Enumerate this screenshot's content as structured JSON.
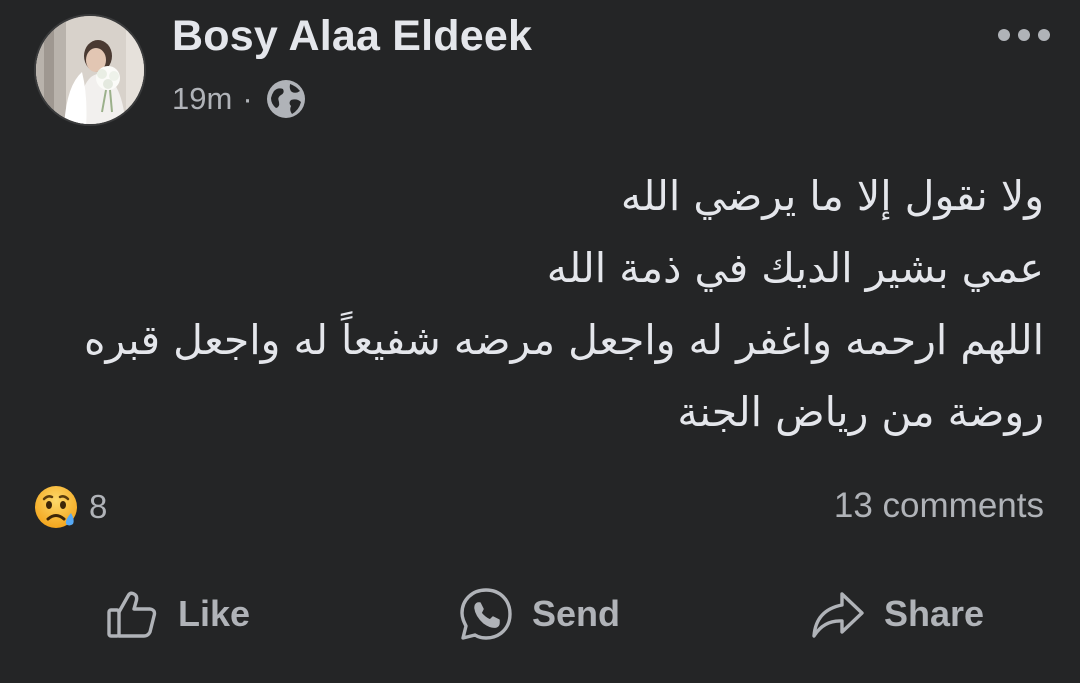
{
  "post": {
    "author": "Bosy Alaa Eldeek",
    "time": "19m",
    "separator": "·",
    "audience_icon": "globe-icon",
    "menu_icon": "more-options-icon",
    "avatar_icon": "profile-photo",
    "text_lines": [
      "ولا نقول إلا ما يرضي الله",
      "عمي بشير الديك في ذمة الله",
      "اللهم ارحمه واغفر له واجعل مرضه شفيعاً له واجعل قبره",
      "روضة من رياض الجنة"
    ]
  },
  "stats": {
    "reaction_icon": "sad-reaction-icon",
    "reaction_count": "8",
    "comments": "13 comments"
  },
  "actions": {
    "like": {
      "label": "Like",
      "icon": "thumbs-up-icon"
    },
    "send": {
      "label": "Send",
      "icon": "messenger-send-icon"
    },
    "share": {
      "label": "Share",
      "icon": "share-arrow-icon"
    }
  },
  "colors": {
    "background": "#242526",
    "primary_text": "#e4e6eb",
    "secondary_text": "#b0b3b8",
    "reaction_yellow": "#f7b125"
  }
}
